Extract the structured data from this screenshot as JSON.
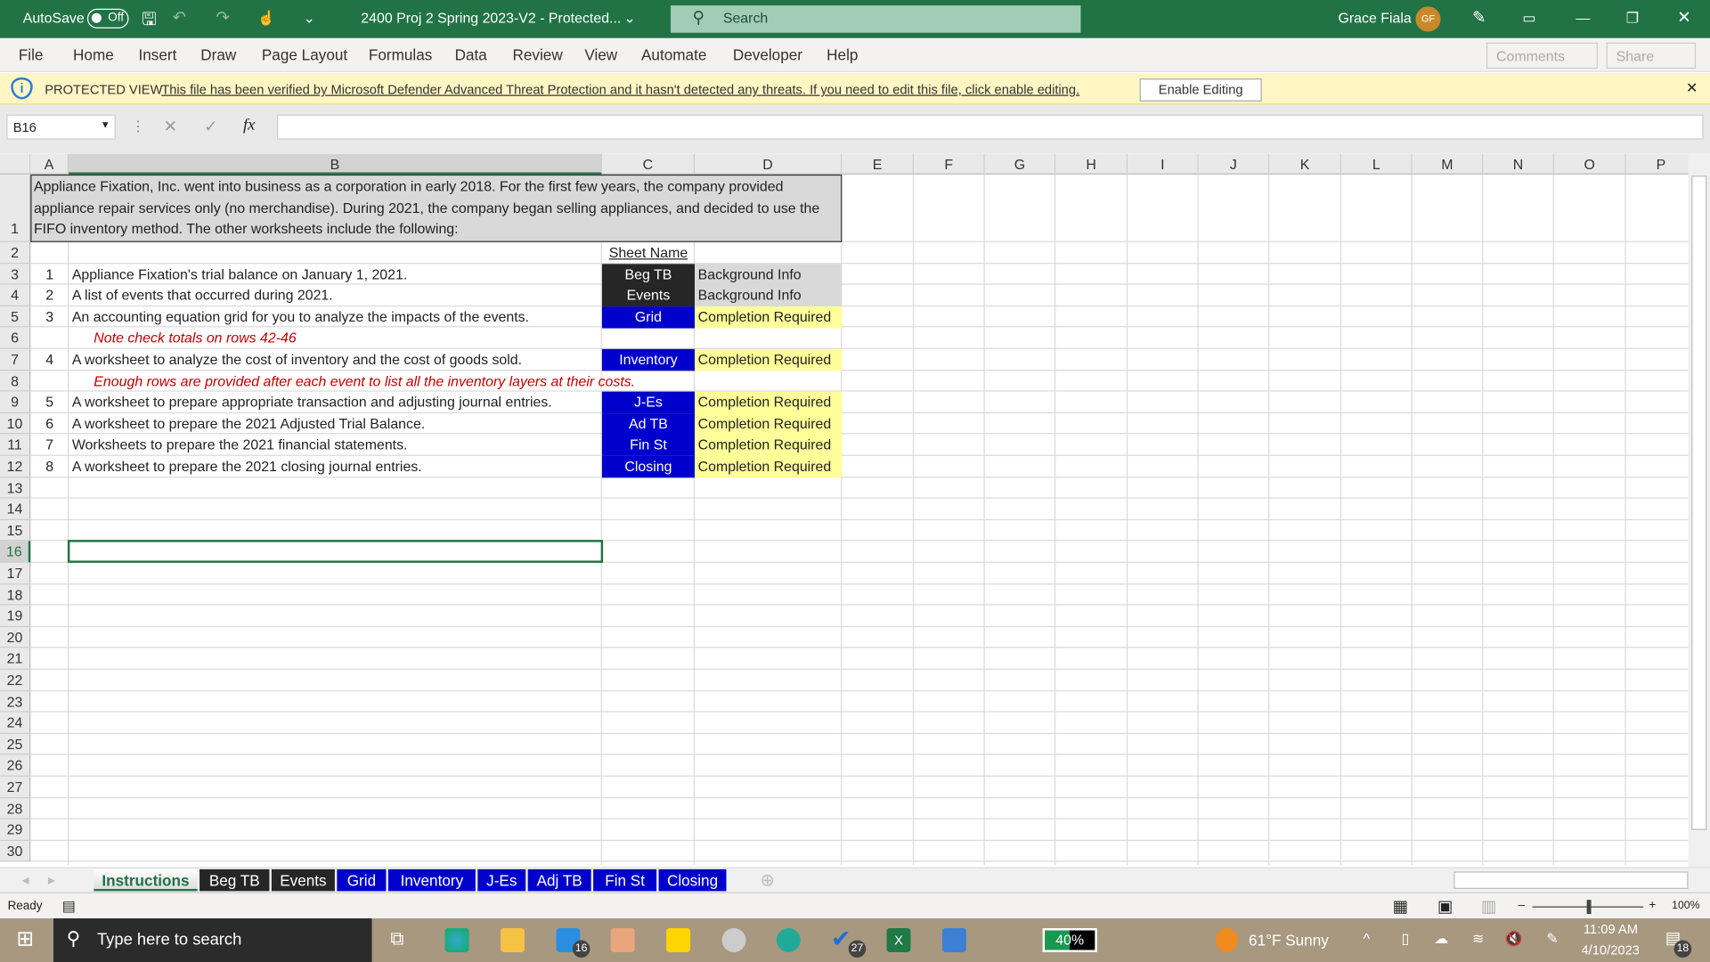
{
  "titlebar": {
    "autosave_label": "AutoSave",
    "autosave_state": "Off",
    "doc_title": "2400 Proj 2 Spring 2023-V2  -  Protected...",
    "search_placeholder": "Search",
    "user_name": "Grace Fiala",
    "user_initials": "GF"
  },
  "menu": {
    "items": [
      "File",
      "Home",
      "Insert",
      "Draw",
      "Page Layout",
      "Formulas",
      "Data",
      "Review",
      "View",
      "Automate",
      "Developer",
      "Help"
    ],
    "comments": "Comments",
    "share": "Share"
  },
  "protected": {
    "label": "PROTECTED VIEW",
    "message": "This file has been verified by Microsoft Defender Advanced Threat Protection and it hasn't detected any threats. If you need to edit this file, click enable editing.",
    "button": "Enable Editing"
  },
  "formula_bar": {
    "name_box": "B16",
    "formula": "",
    "fx": "fx"
  },
  "columns": [
    "A",
    "B",
    "C",
    "D",
    "E",
    "F",
    "G",
    "H",
    "I",
    "J",
    "K",
    "L",
    "M",
    "N",
    "O",
    "P"
  ],
  "rows": [
    1,
    2,
    3,
    4,
    5,
    6,
    7,
    8,
    9,
    10,
    11,
    12,
    13,
    14,
    15,
    16,
    17,
    18,
    19,
    20,
    21,
    22,
    23,
    24,
    25,
    26,
    27,
    28,
    29,
    30
  ],
  "selected_cell": "B16",
  "intro": "Appliance Fixation, Inc. went into business as a corporation in early 2018.  For the first few years, the company provided appliance repair services only (no merchandise).  During 2021, the company began selling appliances, and decided to use the FIFO inventory method.  The other worksheets include the following:",
  "sheet_name_header": "Sheet Name",
  "items": [
    {
      "row": 3,
      "num": "1",
      "desc": "Appliance Fixation's trial balance on January 1, 2021.",
      "sheet": "Beg TB",
      "status": "Background Info",
      "style": "dark"
    },
    {
      "row": 4,
      "num": "2",
      "desc": "A list of events that occurred during 2021.",
      "sheet": "Events",
      "status": "Background Info",
      "style": "dark"
    },
    {
      "row": 5,
      "num": "3",
      "desc": "An accounting equation grid for you to analyze the impacts of the events.",
      "sheet": "Grid",
      "status": "Completion Required",
      "style": "blue"
    },
    {
      "row": 7,
      "num": "4",
      "desc": "A worksheet to analyze the cost of inventory and the cost of goods sold.",
      "sheet": "Inventory",
      "status": "Completion Required",
      "style": "blue"
    },
    {
      "row": 9,
      "num": "5",
      "desc": "A worksheet to prepare appropriate transaction and adjusting journal entries.",
      "sheet": "J-Es",
      "status": "Completion Required",
      "style": "blue"
    },
    {
      "row": 10,
      "num": "6",
      "desc": "A worksheet to prepare the 2021 Adjusted Trial Balance.",
      "sheet": "Ad TB",
      "status": "Completion Required",
      "style": "blue"
    },
    {
      "row": 11,
      "num": "7",
      "desc": "Worksheets to prepare the 2021 financial statements.",
      "sheet": "Fin St",
      "status": "Completion Required",
      "style": "blue"
    },
    {
      "row": 12,
      "num": "8",
      "desc": "A worksheet to prepare the 2021 closing journal entries.",
      "sheet": "Closing",
      "status": "Completion Required",
      "style": "blue"
    }
  ],
  "notes": [
    {
      "row": 6,
      "text": "Note check totals on rows 42-46"
    },
    {
      "row": 8,
      "text": "Enough rows are provided after each event to list all the inventory layers at their costs."
    }
  ],
  "tabs": [
    {
      "label": "Instructions",
      "active": true,
      "color": "#ffffff"
    },
    {
      "label": "Beg TB",
      "color": "#262626"
    },
    {
      "label": "Events",
      "color": "#262626"
    },
    {
      "label": "Grid",
      "color": "#0000cc"
    },
    {
      "label": "Inventory",
      "color": "#0000cc"
    },
    {
      "label": "J-Es",
      "color": "#0000cc"
    },
    {
      "label": "Adj TB",
      "color": "#0000cc"
    },
    {
      "label": "Fin St",
      "color": "#0000cc"
    },
    {
      "label": "Closing",
      "color": "#0000cc"
    }
  ],
  "status": {
    "ready": "Ready",
    "zoom": "100%",
    "zoom_level_percent": 100
  },
  "taskbar": {
    "search_placeholder": "Type here to search",
    "mail_badge": "16",
    "todo_badge": "27",
    "battery": "40%",
    "battery_level_percent": 40,
    "weather": "61°F  Sunny",
    "time": "11:09 AM",
    "date": "4/10/2023",
    "notif_badge": "18"
  },
  "colors": {
    "excel_green": "#217346",
    "protected_yellow": "#fff6c4",
    "dark_tab": "#262626",
    "blue_tab": "#0000cc",
    "completion_yellow": "#ffff99"
  }
}
